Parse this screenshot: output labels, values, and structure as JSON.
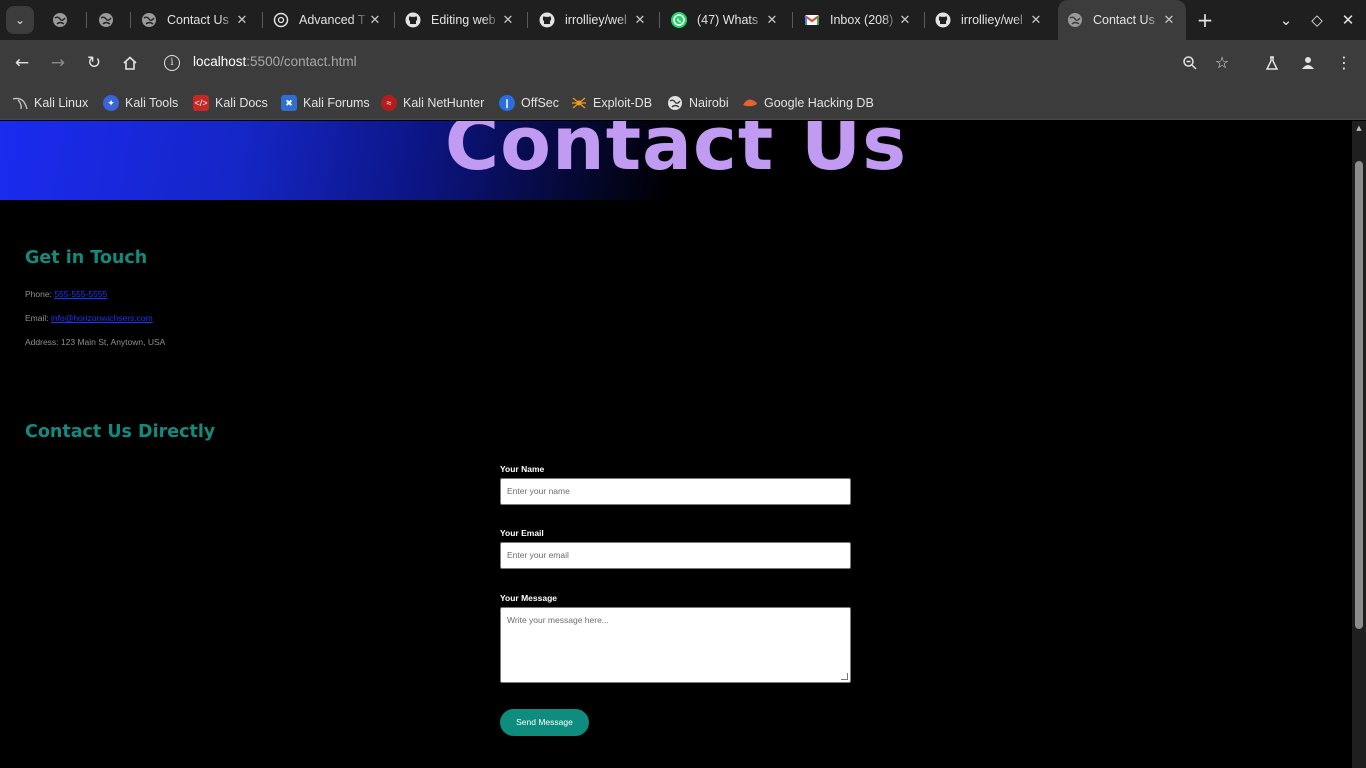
{
  "browser": {
    "tabs": [
      {
        "title": "",
        "favicon": "globe-icon"
      },
      {
        "title": "",
        "favicon": "globe-icon"
      },
      {
        "title": "Contact Us",
        "favicon": "globe-icon"
      },
      {
        "title": "Advanced T",
        "favicon": "openai-icon"
      },
      {
        "title": "Editing web",
        "favicon": "github-icon"
      },
      {
        "title": "irrolliey/wel",
        "favicon": "github-icon"
      },
      {
        "title": "(47) Whats",
        "favicon": "whatsapp-icon"
      },
      {
        "title": "Inbox (208)",
        "favicon": "gmail-icon"
      },
      {
        "title": "irrolliey/wel",
        "favicon": "github-icon"
      },
      {
        "title": "Contact Us",
        "favicon": "globe-icon",
        "active": true
      }
    ],
    "url": {
      "host": "localhost",
      "path": ":5500/contact.html"
    },
    "bookmarks": [
      {
        "label": "Kali Linux",
        "icon": "kali-dragon-icon"
      },
      {
        "label": "Kali Tools",
        "icon": "kali-tools-icon"
      },
      {
        "label": "Kali Docs",
        "icon": "kali-docs-icon"
      },
      {
        "label": "Kali Forums",
        "icon": "kali-forums-icon"
      },
      {
        "label": "Kali NetHunter",
        "icon": "nethunter-icon"
      },
      {
        "label": "OffSec",
        "icon": "offsec-icon"
      },
      {
        "label": "Exploit-DB",
        "icon": "exploit-db-icon"
      },
      {
        "label": "Nairobi",
        "icon": "globe-icon"
      },
      {
        "label": "Google Hacking DB",
        "icon": "ghdb-icon"
      }
    ]
  },
  "page": {
    "hero_title": "Contact Us",
    "get_in_touch": {
      "title": "Get in Touch",
      "phone_label": "Phone:",
      "phone_value": "555-555-5555",
      "email_label": "Email:",
      "email_value": "info@horizonwichsers.com",
      "address": "Address: 123 Main St, Anytown, USA"
    },
    "contact_directly": {
      "title": "Contact Us Directly",
      "name_label": "Your Name",
      "name_placeholder": "Enter your name",
      "email_label": "Your Email",
      "email_placeholder": "Enter your email",
      "message_label": "Your Message",
      "message_placeholder": "Write your message here...",
      "send_button": "Send Message"
    }
  },
  "colors": {
    "hero_gradient_start": "#1b2bf0",
    "hero_title": "#c19bf2",
    "section_title": "#138a7e",
    "link": "#1c33ff",
    "send_button": "#0e8c7e"
  }
}
